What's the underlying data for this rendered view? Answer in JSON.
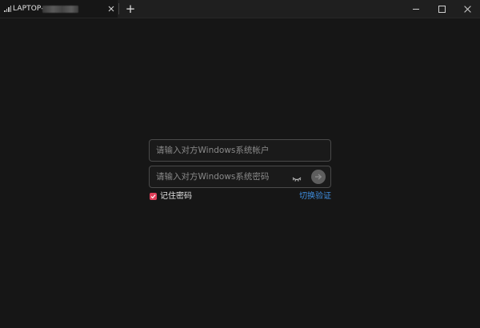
{
  "titlebar": {
    "tab_title": "LAPTOP-",
    "tab_close_icon": "close-icon",
    "new_tab_label": "+",
    "icons": [
      "signal-icon",
      "minimize-icon",
      "maximize-icon",
      "close-icon"
    ]
  },
  "login": {
    "account_placeholder": "请输入对方Windows系统帐户",
    "account_value": "",
    "password_placeholder": "请输入对方Windows系统密码",
    "password_value": "",
    "remember_label": "记住密码",
    "remember_checked": true,
    "switch_label": "切换验证",
    "icons": [
      "eye-icon",
      "arrow-right-icon",
      "check-icon"
    ]
  },
  "colors": {
    "background": "#161616",
    "field_border": "#4a4a4a",
    "checkbox_accent": "#e0405a",
    "link": "#3f8fe0"
  }
}
